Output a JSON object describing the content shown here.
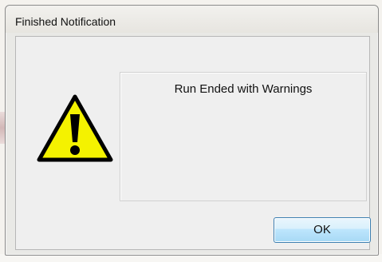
{
  "window": {
    "title": "Finished Notification"
  },
  "dialog": {
    "icon": "warning-icon",
    "message": "Run Ended with Warnings",
    "ok_label": "OK"
  },
  "colors": {
    "icon_fill": "#f4f200",
    "icon_outline": "#000000",
    "button_border": "#3c7fb1"
  }
}
